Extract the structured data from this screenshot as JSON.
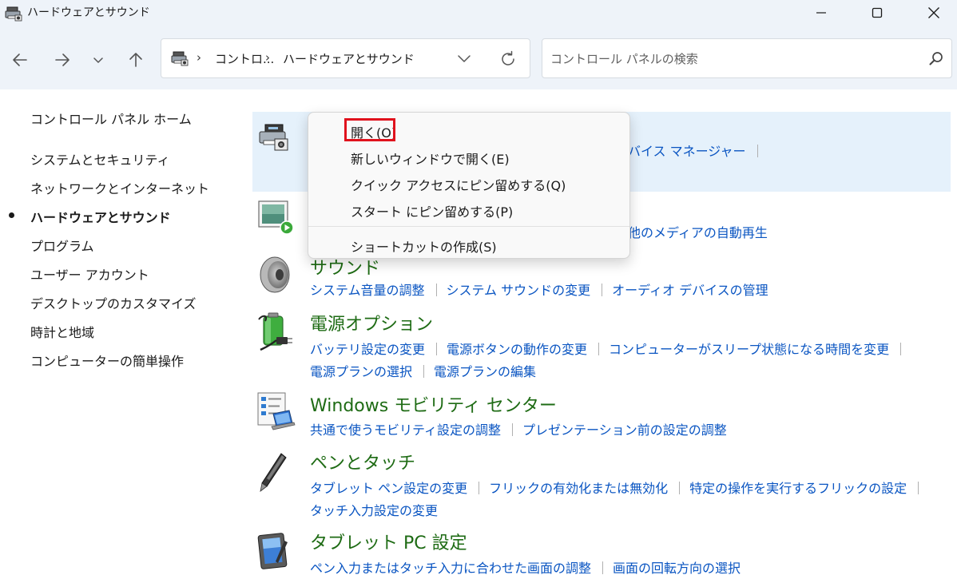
{
  "window": {
    "title": "ハードウェアとサウンド"
  },
  "address": {
    "crumb1": "コントロ...",
    "crumb2": "ハードウェアとサウンド"
  },
  "search": {
    "placeholder": "コントロール パネルの検索"
  },
  "sidebar": {
    "home": "コントロール パネル ホーム",
    "items": [
      "システムとセキュリティ",
      "ネットワークとインターネット",
      "ハードウェアとサウンド",
      "プログラム",
      "ユーザー アカウント",
      "デスクトップのカスタマイズ",
      "時計と地域",
      "コンピューターの簡単操作"
    ],
    "active_index": 2
  },
  "main": {
    "devices": {
      "link_partial": "バイス マネージャー"
    },
    "autoplay": {
      "link_partial": "他のメディアの自動再生"
    },
    "sound": {
      "title_partial": "サウンド",
      "links": [
        "システム音量の調整",
        "システム サウンドの変更",
        "オーディオ デバイスの管理"
      ]
    },
    "power": {
      "title": "電源オプション",
      "links_row1": [
        "バッテリ設定の変更",
        "電源ボタンの動作の変更",
        "コンピューターがスリープ状態になる時間を変更"
      ],
      "links_row2": [
        "電源プランの選択",
        "電源プランの編集"
      ]
    },
    "mobility": {
      "title": "Windows モビリティ センター",
      "links": [
        "共通で使うモビリティ設定の調整",
        "プレゼンテーション前の設定の調整"
      ]
    },
    "pen": {
      "title": "ペンとタッチ",
      "links_row1": [
        "タブレット ペン設定の変更",
        "フリックの有効化または無効化",
        "特定の操作を実行するフリックの設定"
      ],
      "links_row2": [
        "タッチ入力設定の変更"
      ]
    },
    "tablet": {
      "title": "タブレット PC 設定",
      "links": [
        "ペン入力またはタッチ入力に合わせた画面の調整",
        "画面の回転方向の選択"
      ]
    }
  },
  "context_menu": {
    "items": [
      "開く(O)",
      "新しいウィンドウで開く(E)",
      "クイック アクセスにピン留めする(Q)",
      "スタート にピン留めする(P)",
      "ショートカットの作成(S)"
    ],
    "highlighted_index": 0,
    "highlight_color": "#e0121d"
  },
  "colors": {
    "category_title": "#1e6b14",
    "link": "#0a55c2",
    "hover_row": "#e5f1fb",
    "chrome": "#eef3f9"
  },
  "icons": {
    "app": "printer-devices-icon",
    "back": "arrow-left-icon",
    "forward": "arrow-right-icon",
    "recent": "chevron-down-icon",
    "up": "arrow-up-icon",
    "refresh": "refresh-icon",
    "search": "search-icon"
  }
}
